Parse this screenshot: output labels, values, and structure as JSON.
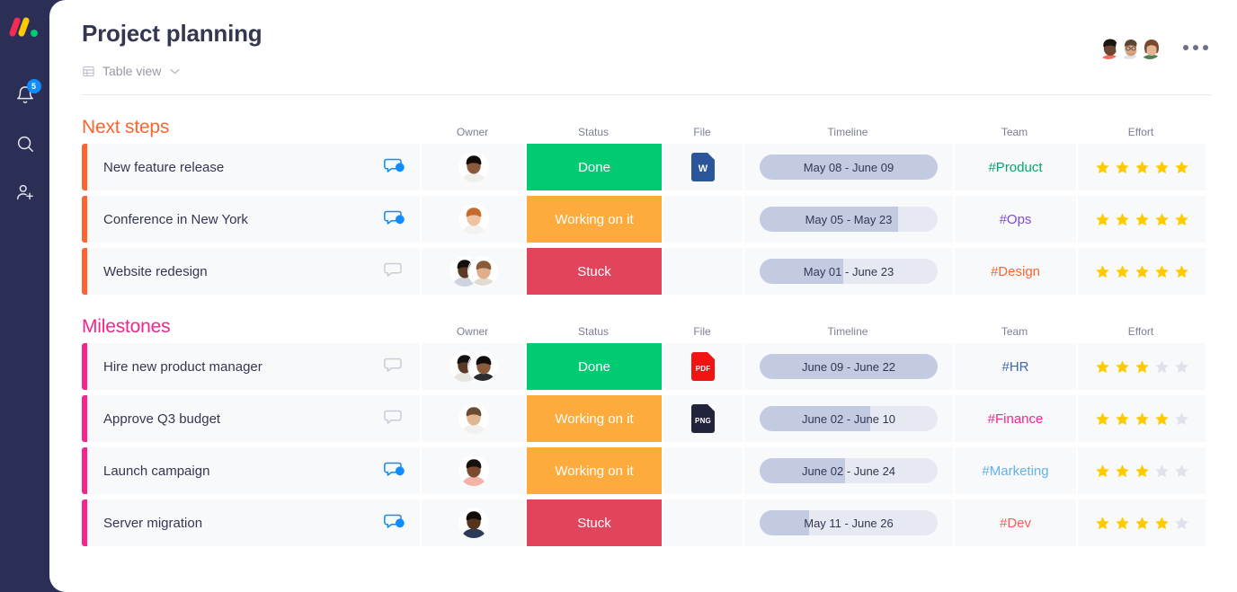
{
  "sidebar": {
    "logo_name": "monday-logo",
    "items": [
      {
        "icon": "bell-icon",
        "name": "notifications",
        "badge": "5"
      },
      {
        "icon": "search-icon",
        "name": "search",
        "badge": ""
      },
      {
        "icon": "invite-user-icon",
        "name": "invite-member",
        "badge": ""
      }
    ]
  },
  "header": {
    "title": "Project planning",
    "view_label": "Table view",
    "view_icon": "table-icon",
    "caret_icon": "chevron-down-icon",
    "more_icon": "more-options-icon",
    "avatars": [
      {
        "name": "avatar-1",
        "skin": "#6b4632",
        "hair": "#1b1510",
        "shirt": "#f07060"
      },
      {
        "name": "avatar-2",
        "skin": "#d9a783",
        "hair": "#5a4432",
        "shirt": "#dfe3ea"
      },
      {
        "name": "avatar-3",
        "skin": "#e3b593",
        "hair": "#7a4a30",
        "shirt": "#4e7f57"
      }
    ]
  },
  "columns": [
    "Owner",
    "Status",
    "File",
    "Timeline",
    "Team",
    "Effort"
  ],
  "colors": {
    "next_steps": "#ff642e",
    "milestones": "#f5258c",
    "done": "#00ca72",
    "working": "#fdab3d",
    "stuck": "#e2445c",
    "pill_track": "#e6e9f2",
    "pill_fill": "#c3cbe3",
    "star_on": "#ffcb00",
    "star_off": "#dfe2ec"
  },
  "groups": [
    {
      "title": "Next steps",
      "color": "#ff642e",
      "rows": [
        {
          "name": "New feature release",
          "bubble": "active",
          "owners": [
            {
              "skin": "#8a5a3b",
              "hair": "#120d0a",
              "shirt": "#f0efe9"
            }
          ],
          "status": {
            "label": "Done",
            "color": "#00ca72"
          },
          "file": {
            "type": "W",
            "bg": "#2b579a",
            "label": "W"
          },
          "timeline": {
            "label": "May 08 - June 09",
            "progress": 100
          },
          "team": {
            "label": "#Product",
            "color": "#00a968"
          },
          "effort": {
            "filled": 5,
            "total": 5
          }
        },
        {
          "name": "Conference in New York",
          "bubble": "active",
          "owners": [
            {
              "skin": "#edc3a0",
              "hair": "#c76a2e",
              "shirt": "#f4f2ee"
            }
          ],
          "status": {
            "label": "Working on it",
            "color": "#fdab3d"
          },
          "file": null,
          "timeline": {
            "label": "May 05 - May 23",
            "progress": 78
          },
          "team": {
            "label": "#Ops",
            "color": "#7e4ad6"
          },
          "effort": {
            "filled": 5,
            "total": 5
          }
        },
        {
          "name": "Website redesign",
          "bubble": "empty",
          "owners": [
            {
              "skin": "#5d3a28",
              "hair": "#141010",
              "shirt": "#cfd3dd"
            },
            {
              "skin": "#e0ae8c",
              "hair": "#8a5a38",
              "shirt": "#e3dbd2"
            }
          ],
          "status": {
            "label": "Stuck",
            "color": "#e2445c"
          },
          "file": null,
          "timeline": {
            "label": "May 01 - June 23",
            "progress": 47
          },
          "team": {
            "label": "#Design",
            "color": "#ff642e"
          },
          "effort": {
            "filled": 5,
            "total": 5
          }
        }
      ]
    },
    {
      "title": "Milestones",
      "color": "#f5258c",
      "rows": [
        {
          "name": "Hire new product manager",
          "bubble": "empty",
          "owners": [
            {
              "skin": "#5a3a27",
              "hair": "#171212",
              "shirt": "#e8e5e0"
            },
            {
              "skin": "#8a5a3b",
              "hair": "#100c09",
              "shirt": "#2b2b30"
            }
          ],
          "status": {
            "label": "Done",
            "color": "#00ca72"
          },
          "file": {
            "type": "PDF",
            "bg": "#f01414",
            "label": "PDF"
          },
          "timeline": {
            "label": "June 09 - June 22",
            "progress": 100
          },
          "team": {
            "label": "#HR",
            "color": "#3d6aa8"
          },
          "effort": {
            "filled": 3,
            "total": 5
          }
        },
        {
          "name": "Approve Q3 budget",
          "bubble": "empty",
          "owners": [
            {
              "skin": "#e0b591",
              "hair": "#6a4b33",
              "shirt": "#f2f0ec"
            }
          ],
          "status": {
            "label": "Working on it",
            "color": "#fdab3d"
          },
          "file": {
            "type": "PNG",
            "bg": "#22243c",
            "label": "PNG"
          },
          "timeline": {
            "label": "June 02 - June 10",
            "progress": 62
          },
          "team": {
            "label": "#Finance",
            "color": "#f5258c"
          },
          "effort": {
            "filled": 4,
            "total": 5
          }
        },
        {
          "name": "Launch campaign",
          "bubble": "active",
          "owners": [
            {
              "skin": "#7a4b2f",
              "hair": "#151010",
              "shirt": "#f4b3a8"
            }
          ],
          "status": {
            "label": "Working on it",
            "color": "#fdab3d"
          },
          "file": null,
          "timeline": {
            "label": "June 02  - June 24",
            "progress": 48
          },
          "team": {
            "label": "#Marketing",
            "color": "#64b1f0"
          },
          "effort": {
            "filled": 3,
            "total": 5
          }
        },
        {
          "name": "Server migration",
          "bubble": "active",
          "owners": [
            {
              "skin": "#54331f",
              "hair": "#0f0b08",
              "shirt": "#2c3a5a"
            }
          ],
          "status": {
            "label": "Stuck",
            "color": "#e2445c"
          },
          "file": null,
          "timeline": {
            "label": "May 11 - June 26",
            "progress": 28
          },
          "team": {
            "label": "#Dev",
            "color": "#ff5b5b"
          },
          "effort": {
            "filled": 4,
            "total": 5
          }
        }
      ]
    }
  ]
}
